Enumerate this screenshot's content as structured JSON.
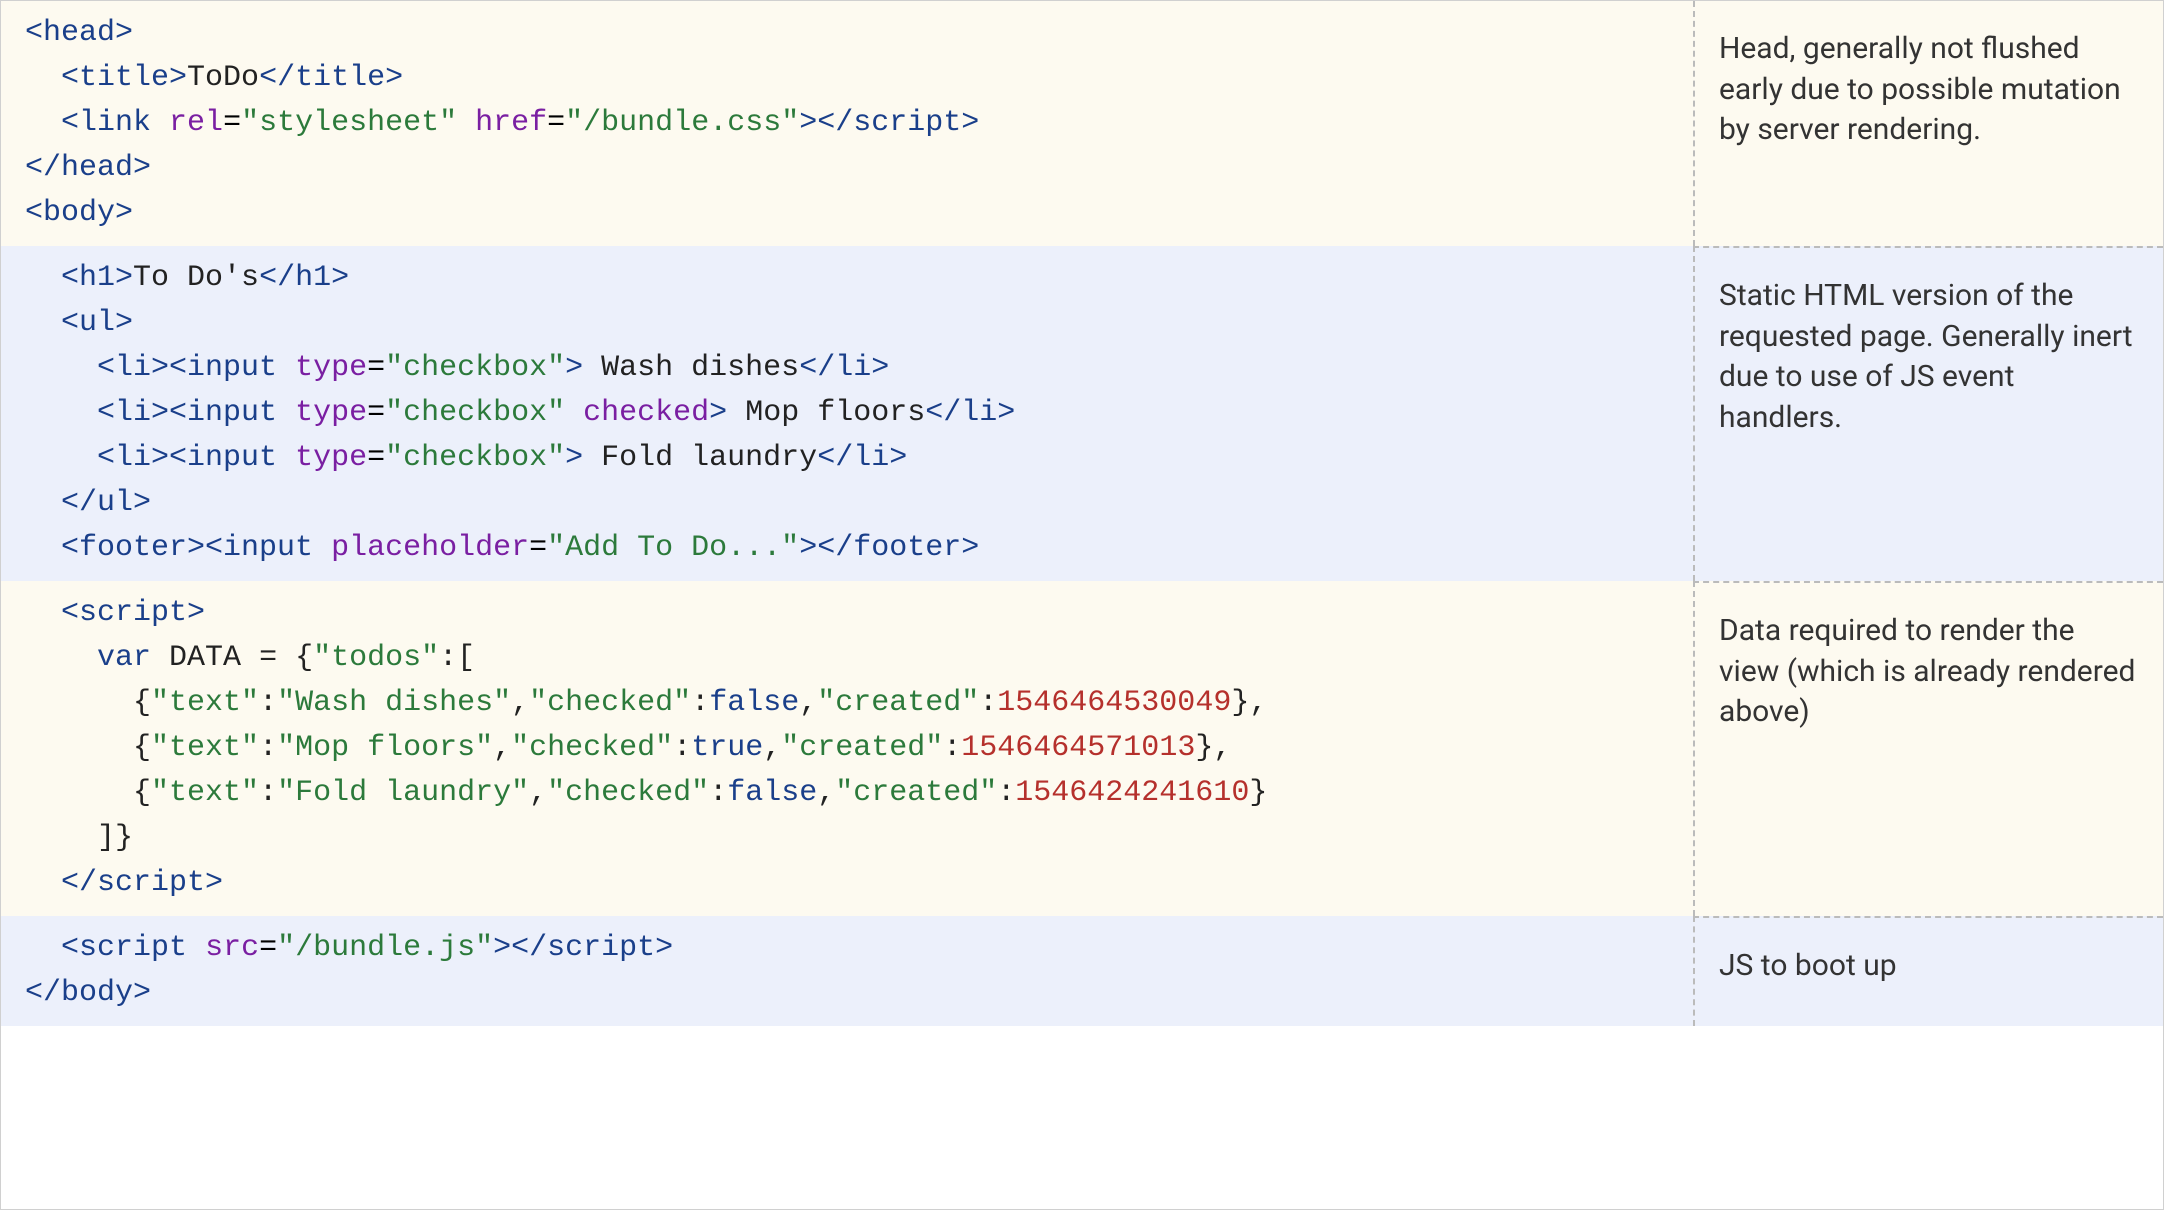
{
  "rows": [
    {
      "bg": "cream",
      "desc": "Head, generally not flushed early due to possible mutation by server rendering.",
      "code_html": "<span class='tag'>&lt;head&gt;</span>\n  <span class='tag'>&lt;title&gt;</span><span class='txt'>ToDo</span><span class='tag'>&lt;/title&gt;</span>\n  <span class='tag'>&lt;link</span> <span class='attr'>rel</span>=<span class='str'>\"stylesheet\"</span> <span class='attr'>href</span>=<span class='str'>\"/bundle.css\"</span><span class='tag'>&gt;&lt;/script&gt;</span>\n<span class='tag'>&lt;/head&gt;</span>\n<span class='tag'>&lt;body&gt;</span>"
    },
    {
      "bg": "lav",
      "desc": "Static HTML version of the requested page. Generally inert due to use of JS event handlers.",
      "code_html": "  <span class='tag'>&lt;h1&gt;</span><span class='txt'>To Do's</span><span class='tag'>&lt;/h1&gt;</span>\n  <span class='tag'>&lt;ul&gt;</span>\n    <span class='tag'>&lt;li&gt;&lt;input</span> <span class='attr'>type</span>=<span class='str'>\"checkbox\"</span><span class='tag'>&gt;</span><span class='txt'> Wash dishes</span><span class='tag'>&lt;/li&gt;</span>\n    <span class='tag'>&lt;li&gt;&lt;input</span> <span class='attr'>type</span>=<span class='str'>\"checkbox\"</span> <span class='attr'>checked</span><span class='tag'>&gt;</span><span class='txt'> Mop floors</span><span class='tag'>&lt;/li&gt;</span>\n    <span class='tag'>&lt;li&gt;&lt;input</span> <span class='attr'>type</span>=<span class='str'>\"checkbox\"</span><span class='tag'>&gt;</span><span class='txt'> Fold laundry</span><span class='tag'>&lt;/li&gt;</span>\n  <span class='tag'>&lt;/ul&gt;</span>\n  <span class='tag'>&lt;footer&gt;&lt;input</span> <span class='attr'>placeholder</span>=<span class='str'>\"Add To Do...\"</span><span class='tag'>&gt;&lt;/footer&gt;</span>"
    },
    {
      "bg": "cream",
      "desc": "Data required to render the view (which is already rendered above)",
      "code_html": "  <span class='tag'>&lt;script&gt;</span>\n    <span class='kw'>var</span> <span class='txt'>DATA</span> <span class='txt'>=</span> <span class='txt'>{</span><span class='key'>\"todos\"</span><span class='txt'>:[</span>\n      <span class='txt'>{</span><span class='key'>\"text\"</span><span class='txt'>:</span><span class='str'>\"Wash dishes\"</span><span class='txt'>,</span><span class='key'>\"checked\"</span><span class='txt'>:</span><span class='bool'>false</span><span class='txt'>,</span><span class='key'>\"created\"</span><span class='txt'>:</span><span class='num'>1546464530049</span><span class='txt'>},</span>\n      <span class='txt'>{</span><span class='key'>\"text\"</span><span class='txt'>:</span><span class='str'>\"Mop floors\"</span><span class='txt'>,</span><span class='key'>\"checked\"</span><span class='txt'>:</span><span class='bool'>true</span><span class='txt'>,</span><span class='key'>\"created\"</span><span class='txt'>:</span><span class='num'>1546464571013</span><span class='txt'>},</span>\n      <span class='txt'>{</span><span class='key'>\"text\"</span><span class='txt'>:</span><span class='str'>\"Fold laundry\"</span><span class='txt'>,</span><span class='key'>\"checked\"</span><span class='txt'>:</span><span class='bool'>false</span><span class='txt'>,</span><span class='key'>\"created\"</span><span class='txt'>:</span><span class='num'>1546424241610</span><span class='txt'>}</span>\n    <span class='txt'>]}</span>\n  <span class='tag'>&lt;/script&gt;</span>"
    },
    {
      "bg": "lav",
      "desc": "JS to boot up",
      "code_html": "  <span class='tag'>&lt;script</span> <span class='attr'>src</span>=<span class='str'>\"/bundle.js\"</span><span class='tag'>&gt;&lt;/script&gt;</span>\n<span class='tag'>&lt;/body&gt;</span>"
    }
  ],
  "code_content": {
    "title_text": "ToDo",
    "stylesheet_href": "/bundle.css",
    "h1_text": "To Do's",
    "todo_items": [
      {
        "text": "Wash dishes",
        "checked": false
      },
      {
        "text": "Mop floors",
        "checked": true
      },
      {
        "text": "Fold laundry",
        "checked": false
      }
    ],
    "placeholder_text": "Add To Do...",
    "data_var_name": "DATA",
    "data_todos": [
      {
        "text": "Wash dishes",
        "checked": false,
        "created": 1546464530049
      },
      {
        "text": "Mop floors",
        "checked": true,
        "created": 1546464571013
      },
      {
        "text": "Fold laundry",
        "checked": false,
        "created": 1546424241610
      }
    ],
    "script_src": "/bundle.js"
  }
}
